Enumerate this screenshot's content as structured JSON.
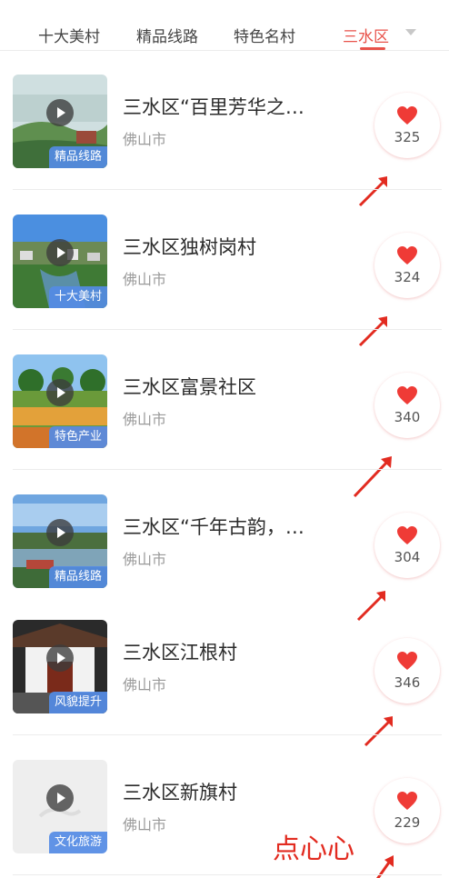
{
  "tabs": [
    {
      "label": "十大美村"
    },
    {
      "label": "精品线路"
    },
    {
      "label": "特色名村"
    },
    {
      "label": "三水区"
    }
  ],
  "active_tab": "三水区",
  "items": [
    {
      "title": "三水区“百里芳华之…",
      "city": "佛山市",
      "tag": "精品线路",
      "likes": "325"
    },
    {
      "title": "三水区独树岗村",
      "city": "佛山市",
      "tag": "十大美村",
      "likes": "324"
    },
    {
      "title": "三水区富景社区",
      "city": "佛山市",
      "tag": "特色产业",
      "likes": "340"
    },
    {
      "title": "三水区“千年古韵，…",
      "city": "佛山市",
      "tag": "精品线路",
      "likes": "304"
    },
    {
      "title": "三水区江根村",
      "city": "佛山市",
      "tag": "风貌提升",
      "likes": "346"
    },
    {
      "title": "三水区新旗村",
      "city": "佛山市",
      "tag": "文化旅游",
      "likes": "229"
    }
  ],
  "annotation": {
    "text": "点心心"
  },
  "colors": {
    "accent": "#e8524a",
    "tag_bg": "#548be5",
    "annotation": "#e22b20"
  }
}
